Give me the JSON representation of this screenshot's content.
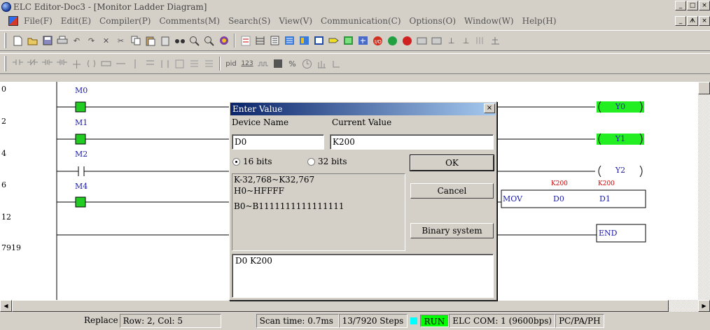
{
  "window": {
    "title": "ELC Editor-Doc3 - [Monitor Ladder Diagram]",
    "controls": [
      "_",
      "□",
      "×"
    ],
    "mdi_controls": [
      "_",
      "ᗗ",
      "×"
    ]
  },
  "menu": [
    "File(F)",
    "Edit(E)",
    "Compiler(P)",
    "Comments(M)",
    "Search(S)",
    "View(V)",
    "Communication(C)",
    "Options(O)",
    "Window(W)",
    "Help(H)"
  ],
  "toolbar2_text": {
    "pid": "pid",
    "num": "123"
  },
  "ladder": {
    "rungs": [
      {
        "no": "0"
      },
      {
        "no": "2"
      },
      {
        "no": "4"
      },
      {
        "no": "6"
      },
      {
        "no": "12"
      },
      {
        "no": "7919"
      }
    ],
    "contacts": [
      {
        "label": "M0",
        "state": "on"
      },
      {
        "label": "M1",
        "state": "on"
      },
      {
        "label": "M2",
        "state": "off"
      },
      {
        "label": "M4",
        "state": "on"
      }
    ],
    "coils": [
      {
        "label": "Y0",
        "state": "on"
      },
      {
        "label": "Y1",
        "state": "on"
      },
      {
        "label": "Y2",
        "state": "off"
      }
    ],
    "mov": {
      "op": "MOV",
      "src": "D0",
      "dst": "D1",
      "src_value": "K200",
      "dst_value": "K200"
    },
    "end": "END"
  },
  "dialog": {
    "title": "Enter Value",
    "close": "×",
    "device_name_label": "Device Name",
    "current_value_label": "Current Value",
    "device_name_value": "D0",
    "current_value": "K200",
    "radio_16": "16 bits",
    "radio_32": "32 bits",
    "range": [
      "K-32,768~K32,767",
      "H0~HFFFF",
      "B0~B1111111111111111"
    ],
    "ok": "OK",
    "cancel": "Cancel",
    "binary": "Binary system",
    "history": "D0 K200"
  },
  "status": {
    "mode": "Replace",
    "position": "Row: 2, Col: 5",
    "scan_time": "Scan time: 0.7ms",
    "steps": "13/7920 Steps",
    "run": "RUN",
    "comm": "ELC COM: 1 (9600bps)",
    "model": "PC/PA/PH"
  }
}
